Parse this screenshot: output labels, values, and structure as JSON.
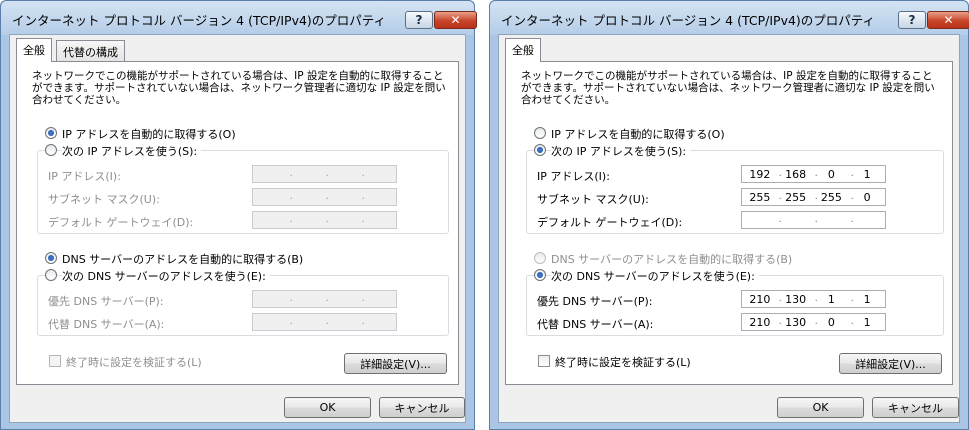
{
  "dialogs": [
    {
      "title": "インターネット プロトコル バージョン 4 (TCP/IPv4)のプロパティ",
      "tabs": [
        "全般",
        "代替の構成"
      ],
      "description": "ネットワークでこの機能がサポートされている場合は、IP 設定を自動的に取得することができます。サポートされていない場合は、ネットワーク管理者に適切な IP 設定を問い合わせてください。",
      "ip_auto_label": "IP アドレスを自動的に取得する(O)",
      "ip_manual_label": "次の IP アドレスを使う(S):",
      "ip_mode": "auto",
      "fields": [
        {
          "label": "IP アドレス(I):",
          "value": [
            "",
            "",
            "",
            ""
          ]
        },
        {
          "label": "サブネット マスク(U):",
          "value": [
            "",
            "",
            "",
            ""
          ]
        },
        {
          "label": "デフォルト ゲートウェイ(D):",
          "value": [
            "",
            "",
            "",
            ""
          ]
        }
      ],
      "dns_auto_label": "DNS サーバーのアドレスを自動的に取得する(B)",
      "dns_manual_label": "次の DNS サーバーのアドレスを使う(E):",
      "dns_mode": "auto",
      "dns_fields": [
        {
          "label": "優先 DNS サーバー(P):",
          "value": [
            "",
            "",
            "",
            ""
          ]
        },
        {
          "label": "代替 DNS サーバー(A):",
          "value": [
            "",
            "",
            "",
            ""
          ]
        }
      ],
      "validate_label": "終了時に設定を検証する(L)",
      "advanced_label": "詳細設定(V)...",
      "ok_label": "OK",
      "cancel_label": "キャンセル"
    },
    {
      "title": "インターネット プロトコル バージョン 4 (TCP/IPv4)のプロパティ",
      "tabs": [
        "全般"
      ],
      "description": "ネットワークでこの機能がサポートされている場合は、IP 設定を自動的に取得することができます。サポートされていない場合は、ネットワーク管理者に適切な IP 設定を問い合わせてください。",
      "ip_auto_label": "IP アドレスを自動的に取得する(O)",
      "ip_manual_label": "次の IP アドレスを使う(S):",
      "ip_mode": "manual",
      "fields": [
        {
          "label": "IP アドレス(I):",
          "value": [
            "192",
            "168",
            "0",
            "1"
          ]
        },
        {
          "label": "サブネット マスク(U):",
          "value": [
            "255",
            "255",
            "255",
            "0"
          ]
        },
        {
          "label": "デフォルト ゲートウェイ(D):",
          "value": [
            "",
            "",
            "",
            ""
          ]
        }
      ],
      "dns_auto_label": "DNS サーバーのアドレスを自動的に取得する(B)",
      "dns_manual_label": "次の DNS サーバーのアドレスを使う(E):",
      "dns_mode": "manual",
      "dns_fields": [
        {
          "label": "優先 DNS サーバー(P):",
          "value": [
            "210",
            "130",
            "1",
            "1"
          ]
        },
        {
          "label": "代替 DNS サーバー(A):",
          "value": [
            "210",
            "130",
            "0",
            "1"
          ]
        }
      ],
      "validate_label": "終了時に設定を検証する(L)",
      "advanced_label": "詳細設定(V)...",
      "ok_label": "OK",
      "cancel_label": "キャンセル"
    }
  ],
  "titlebar": {
    "help_icon": "?",
    "close_icon": "✕"
  }
}
